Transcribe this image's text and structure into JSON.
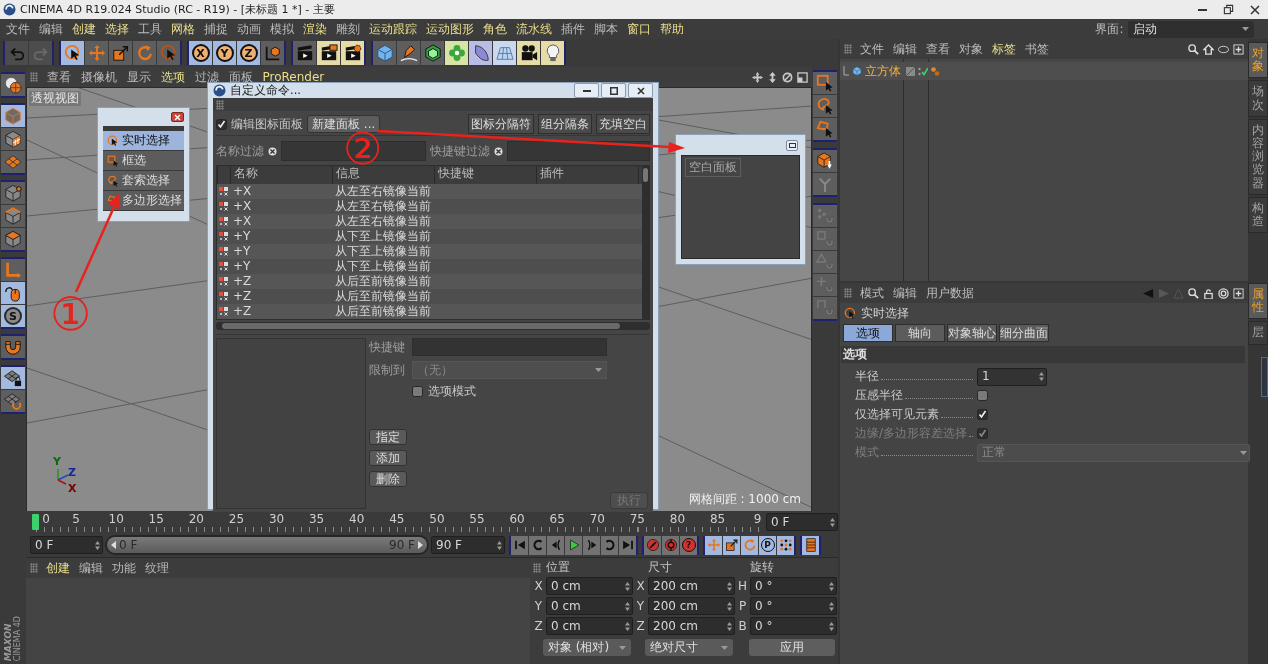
{
  "window": {
    "title": "CINEMA 4D R19.024 Studio (RC - R19) - [未标题 1 *] - 主要"
  },
  "menu_bar": {
    "items": [
      {
        "label": "文件",
        "highlighted": false
      },
      {
        "label": "编辑",
        "highlighted": false
      },
      {
        "label": "创建",
        "highlighted": true
      },
      {
        "label": "选择",
        "highlighted": true
      },
      {
        "label": "工具",
        "highlighted": false
      },
      {
        "label": "网格",
        "highlighted": true
      },
      {
        "label": "捕捉",
        "highlighted": false
      },
      {
        "label": "动画",
        "highlighted": false
      },
      {
        "label": "模拟",
        "highlighted": false
      },
      {
        "label": "渲染",
        "highlighted": true
      },
      {
        "label": "雕刻",
        "highlighted": false
      },
      {
        "label": "运动跟踪",
        "highlighted": true
      },
      {
        "label": "运动图形",
        "highlighted": true
      },
      {
        "label": "角色",
        "highlighted": true
      },
      {
        "label": "流水线",
        "highlighted": true
      },
      {
        "label": "插件",
        "highlighted": false
      },
      {
        "label": "脚本",
        "highlighted": false
      },
      {
        "label": "窗口",
        "highlighted": true
      },
      {
        "label": "帮助",
        "highlighted": true
      }
    ],
    "layout_label": "界面:",
    "layout_value": "启动"
  },
  "toolbar": {
    "groups": [
      [
        {
          "kind": "undo",
          "active": false
        },
        {
          "kind": "redo",
          "active": false
        }
      ],
      [
        {
          "kind": "live_select",
          "active": true
        },
        {
          "kind": "move",
          "active": false
        },
        {
          "kind": "scale",
          "active": false
        },
        {
          "kind": "rotate",
          "active": false
        },
        {
          "kind": "last_tool",
          "active": false
        }
      ],
      [
        {
          "kind": "axis",
          "label": "X",
          "active": true
        },
        {
          "kind": "axis",
          "label": "Y",
          "active": true
        },
        {
          "kind": "axis",
          "label": "Z",
          "active": true
        },
        {
          "kind": "coord",
          "active": false
        }
      ],
      [
        {
          "kind": "render_view",
          "active": false
        },
        {
          "kind": "render_pv",
          "active": false
        },
        {
          "kind": "render_settings",
          "active": false
        }
      ],
      [
        {
          "kind": "cube",
          "active": false
        },
        {
          "kind": "pen",
          "active": false
        },
        {
          "kind": "subdiv",
          "active": false
        },
        {
          "kind": "cloner",
          "active": false
        },
        {
          "kind": "bend",
          "active": false
        },
        {
          "kind": "floor",
          "active": false
        },
        {
          "kind": "camera",
          "active": false
        },
        {
          "kind": "light",
          "active": false
        }
      ]
    ]
  },
  "left_strip": {
    "groups": [
      [
        {
          "kind": "make_editable",
          "active": false
        }
      ],
      [
        {
          "kind": "model",
          "active": true
        },
        {
          "kind": "texture",
          "active": false
        },
        {
          "kind": "workplane",
          "active": false
        }
      ],
      [
        {
          "kind": "points",
          "active": false
        },
        {
          "kind": "edges",
          "active": false
        },
        {
          "kind": "polygons",
          "active": false
        }
      ],
      [
        {
          "kind": "axis_mode",
          "active": false
        },
        {
          "kind": "tweak",
          "active": true
        },
        {
          "kind": "solo",
          "label": "S",
          "active": true
        }
      ],
      [
        {
          "kind": "snap",
          "active": false
        }
      ],
      [
        {
          "kind": "grid_lock",
          "active": true
        },
        {
          "kind": "grid_planar",
          "active": false
        }
      ]
    ]
  },
  "logo": {
    "brand": "MAXON",
    "product": "CINEMA 4D"
  },
  "viewport": {
    "menu": [
      {
        "label": "查看",
        "highlighted": false
      },
      {
        "label": "摄像机",
        "highlighted": false
      },
      {
        "label": "显示",
        "highlighted": false
      },
      {
        "label": "选项",
        "highlighted": true
      },
      {
        "label": "过滤",
        "highlighted": false
      },
      {
        "label": "面板",
        "highlighted": false
      },
      {
        "label": "ProRender",
        "highlighted": true
      }
    ],
    "view_label": "透视视图",
    "axes": {
      "y": "Y",
      "z": "Z",
      "x": "X"
    },
    "grid_spacing": "网格间距 : 1000 cm"
  },
  "right_strip": {
    "groups": [
      [
        {
          "kind": "rect_select",
          "active": false
        },
        {
          "kind": "lasso_select",
          "active": false
        },
        {
          "kind": "polygon_select",
          "active": false
        }
      ],
      [
        {
          "kind": "cube_arrow",
          "active": false
        },
        {
          "kind": "branch",
          "active": false
        }
      ],
      [
        {
          "kind": "snap_points",
          "active": false
        },
        {
          "kind": "snap_square",
          "active": false
        },
        {
          "kind": "snap_triangle",
          "active": false
        },
        {
          "kind": "snap_cross",
          "active": false
        },
        {
          "kind": "snap_corner",
          "active": false
        }
      ]
    ]
  },
  "timeline": {
    "labels": [
      "0",
      "5",
      "10",
      "15",
      "20",
      "25",
      "30",
      "35",
      "40",
      "45",
      "50",
      "55",
      "60",
      "65",
      "70",
      "75",
      "80",
      "85",
      "9"
    ],
    "playhead": {
      "level": 0
    },
    "frame_field": "0 F"
  },
  "time_controls": {
    "start_field": "0 F",
    "range": {
      "start": "0 F",
      "end": "90 F",
      "level": 1
    },
    "end_field": "90 F",
    "groups": [
      [
        {
          "kind": "go_start",
          "active": false
        },
        {
          "kind": "prev_key",
          "active": false
        },
        {
          "kind": "prev_frame",
          "active": false
        },
        {
          "kind": "play",
          "active": false
        },
        {
          "kind": "next_frame",
          "active": false
        },
        {
          "kind": "next_key",
          "active": false
        },
        {
          "kind": "go_end",
          "active": false
        }
      ],
      [
        {
          "kind": "record",
          "active": false
        },
        {
          "kind": "auto_key",
          "active": false
        },
        {
          "kind": "key_help",
          "label": "?",
          "active": false
        }
      ],
      [
        {
          "kind": "move",
          "active": true
        },
        {
          "kind": "scale",
          "active": true
        },
        {
          "kind": "rotate",
          "active": true
        },
        {
          "kind": "key_param",
          "label": "P",
          "active": true
        },
        {
          "kind": "key_points",
          "active": true
        }
      ],
      [
        {
          "kind": "timeline",
          "active": true
        }
      ]
    ]
  },
  "material_manager": {
    "menu": [
      {
        "label": "创建",
        "highlighted": true
      },
      {
        "label": "编辑",
        "highlighted": false
      },
      {
        "label": "功能",
        "highlighted": false
      },
      {
        "label": "纹理",
        "highlighted": false
      }
    ]
  },
  "coordinates": {
    "headers": [
      "位置",
      "尺寸",
      "旋转"
    ],
    "rows": [
      [
        {
          "axis": "X",
          "value": "0 cm"
        },
        {
          "axis": "X",
          "value": "200 cm"
        },
        {
          "axis": "H",
          "value": "0 °"
        }
      ],
      [
        {
          "axis": "Y",
          "value": "0 cm"
        },
        {
          "axis": "Y",
          "value": "200 cm"
        },
        {
          "axis": "P",
          "value": "0 °"
        }
      ],
      [
        {
          "axis": "Z",
          "value": "0 cm"
        },
        {
          "axis": "Z",
          "value": "200 cm"
        },
        {
          "axis": "B",
          "value": "0 °"
        }
      ]
    ],
    "mode": "对象 (相对)",
    "size_mode": "绝对尺寸",
    "apply": "应用"
  },
  "object_manager": {
    "menu": [
      {
        "label": "文件",
        "highlighted": false
      },
      {
        "label": "编辑",
        "highlighted": false
      },
      {
        "label": "查看",
        "highlighted": false
      },
      {
        "label": "对象",
        "highlighted": false
      },
      {
        "label": "标签",
        "highlighted": true
      },
      {
        "label": "书签",
        "highlighted": false
      }
    ],
    "objects": [
      {
        "name": "立方体",
        "selected": true,
        "enabled": true
      }
    ]
  },
  "attributes": {
    "menu": [
      {
        "label": "模式",
        "highlighted": false
      },
      {
        "label": "编辑",
        "highlighted": false
      },
      {
        "label": "用户数据",
        "highlighted": false
      }
    ],
    "title": "实时选择",
    "tabs": [
      {
        "label": "选项",
        "selected": true
      },
      {
        "label": "轴向",
        "selected": false
      },
      {
        "label": "对象轴心",
        "selected": false
      },
      {
        "label": "细分曲面",
        "selected": false
      }
    ],
    "section": "选项",
    "rows": [
      {
        "kind": "number",
        "label": "半径",
        "value": "1",
        "disabled": false
      },
      {
        "kind": "checkbox",
        "label": "压感半径",
        "checked": false,
        "disabled": false
      },
      {
        "kind": "checkbox",
        "label": "仅选择可见元素",
        "checked": true,
        "disabled": false
      },
      {
        "kind": "checkbox",
        "label": "边缘/多边形容差选择",
        "checked": true,
        "disabled": true
      },
      {
        "kind": "dropdown",
        "label": "模式",
        "value": "正常",
        "disabled": true
      }
    ]
  },
  "side_tabs": {
    "upper": [
      {
        "label": "对象",
        "selected": true
      },
      {
        "label": "场次",
        "selected": false
      },
      {
        "label": "内容浏览器",
        "selected": false
      },
      {
        "label": "构造",
        "selected": false
      }
    ],
    "lower": [
      {
        "label": "属性",
        "selected": true
      },
      {
        "label": "层",
        "selected": false
      }
    ]
  },
  "palette": {
    "items": [
      {
        "kind": "live_select",
        "label": "实时选择",
        "selected": true
      },
      {
        "kind": "rect_select",
        "label": "框选",
        "selected": false
      },
      {
        "kind": "lasso_select",
        "label": "套索选择",
        "selected": false
      },
      {
        "kind": "polygon_select",
        "label": "多边形选择",
        "selected": false
      }
    ]
  },
  "dialog": {
    "title": "自定义命令...",
    "edit_palette": {
      "label": "编辑图标面板",
      "checked": true
    },
    "new_panel_button": "新建面板 ...",
    "right_buttons": [
      "图标分隔符",
      "组分隔条",
      "充填空白"
    ],
    "name_filter": "名称过滤",
    "shortcut_filter": "快捷键过滤",
    "columns": [
      "名称",
      "信息",
      "快捷键",
      "插件"
    ],
    "rows": [
      {
        "name": "+X",
        "info": "从左至右镜像当前"
      },
      {
        "name": "+X",
        "info": "从左至右镜像当前"
      },
      {
        "name": "+X",
        "info": "从左至右镜像当前"
      },
      {
        "name": "+Y",
        "info": "从下至上镜像当前"
      },
      {
        "name": "+Y",
        "info": "从下至上镜像当前"
      },
      {
        "name": "+Y",
        "info": "从下至上镜像当前"
      },
      {
        "name": "+Z",
        "info": "从后至前镜像当前"
      },
      {
        "name": "+Z",
        "info": "从后至前镜像当前"
      },
      {
        "name": "+Z",
        "info": "从后至前镜像当前"
      }
    ],
    "shortcut_label": "快捷键",
    "restrict_label": "限制到",
    "restrict_value": "（无）",
    "option_mode": {
      "label": "选项模式",
      "checked": false
    },
    "buttons": [
      "指定",
      "添加",
      "删除"
    ],
    "execute_button": "执行"
  },
  "blank_panel": {
    "label": "空白面板"
  },
  "annotations": [
    {
      "label": "①"
    },
    {
      "label": "②"
    }
  ]
}
